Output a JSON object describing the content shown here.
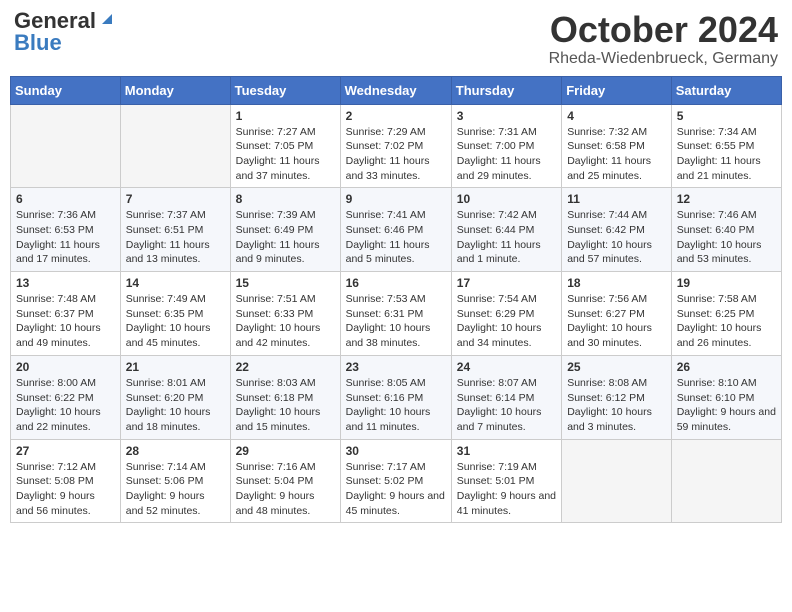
{
  "header": {
    "logo_general": "General",
    "logo_blue": "Blue",
    "month": "October 2024",
    "location": "Rheda-Wiedenbrueck, Germany"
  },
  "weekdays": [
    "Sunday",
    "Monday",
    "Tuesday",
    "Wednesday",
    "Thursday",
    "Friday",
    "Saturday"
  ],
  "weeks": [
    [
      {
        "day": "",
        "content": ""
      },
      {
        "day": "",
        "content": ""
      },
      {
        "day": "1",
        "content": "Sunrise: 7:27 AM\nSunset: 7:05 PM\nDaylight: 11 hours and 37 minutes."
      },
      {
        "day": "2",
        "content": "Sunrise: 7:29 AM\nSunset: 7:02 PM\nDaylight: 11 hours and 33 minutes."
      },
      {
        "day": "3",
        "content": "Sunrise: 7:31 AM\nSunset: 7:00 PM\nDaylight: 11 hours and 29 minutes."
      },
      {
        "day": "4",
        "content": "Sunrise: 7:32 AM\nSunset: 6:58 PM\nDaylight: 11 hours and 25 minutes."
      },
      {
        "day": "5",
        "content": "Sunrise: 7:34 AM\nSunset: 6:55 PM\nDaylight: 11 hours and 21 minutes."
      }
    ],
    [
      {
        "day": "6",
        "content": "Sunrise: 7:36 AM\nSunset: 6:53 PM\nDaylight: 11 hours and 17 minutes."
      },
      {
        "day": "7",
        "content": "Sunrise: 7:37 AM\nSunset: 6:51 PM\nDaylight: 11 hours and 13 minutes."
      },
      {
        "day": "8",
        "content": "Sunrise: 7:39 AM\nSunset: 6:49 PM\nDaylight: 11 hours and 9 minutes."
      },
      {
        "day": "9",
        "content": "Sunrise: 7:41 AM\nSunset: 6:46 PM\nDaylight: 11 hours and 5 minutes."
      },
      {
        "day": "10",
        "content": "Sunrise: 7:42 AM\nSunset: 6:44 PM\nDaylight: 11 hours and 1 minute."
      },
      {
        "day": "11",
        "content": "Sunrise: 7:44 AM\nSunset: 6:42 PM\nDaylight: 10 hours and 57 minutes."
      },
      {
        "day": "12",
        "content": "Sunrise: 7:46 AM\nSunset: 6:40 PM\nDaylight: 10 hours and 53 minutes."
      }
    ],
    [
      {
        "day": "13",
        "content": "Sunrise: 7:48 AM\nSunset: 6:37 PM\nDaylight: 10 hours and 49 minutes."
      },
      {
        "day": "14",
        "content": "Sunrise: 7:49 AM\nSunset: 6:35 PM\nDaylight: 10 hours and 45 minutes."
      },
      {
        "day": "15",
        "content": "Sunrise: 7:51 AM\nSunset: 6:33 PM\nDaylight: 10 hours and 42 minutes."
      },
      {
        "day": "16",
        "content": "Sunrise: 7:53 AM\nSunset: 6:31 PM\nDaylight: 10 hours and 38 minutes."
      },
      {
        "day": "17",
        "content": "Sunrise: 7:54 AM\nSunset: 6:29 PM\nDaylight: 10 hours and 34 minutes."
      },
      {
        "day": "18",
        "content": "Sunrise: 7:56 AM\nSunset: 6:27 PM\nDaylight: 10 hours and 30 minutes."
      },
      {
        "day": "19",
        "content": "Sunrise: 7:58 AM\nSunset: 6:25 PM\nDaylight: 10 hours and 26 minutes."
      }
    ],
    [
      {
        "day": "20",
        "content": "Sunrise: 8:00 AM\nSunset: 6:22 PM\nDaylight: 10 hours and 22 minutes."
      },
      {
        "day": "21",
        "content": "Sunrise: 8:01 AM\nSunset: 6:20 PM\nDaylight: 10 hours and 18 minutes."
      },
      {
        "day": "22",
        "content": "Sunrise: 8:03 AM\nSunset: 6:18 PM\nDaylight: 10 hours and 15 minutes."
      },
      {
        "day": "23",
        "content": "Sunrise: 8:05 AM\nSunset: 6:16 PM\nDaylight: 10 hours and 11 minutes."
      },
      {
        "day": "24",
        "content": "Sunrise: 8:07 AM\nSunset: 6:14 PM\nDaylight: 10 hours and 7 minutes."
      },
      {
        "day": "25",
        "content": "Sunrise: 8:08 AM\nSunset: 6:12 PM\nDaylight: 10 hours and 3 minutes."
      },
      {
        "day": "26",
        "content": "Sunrise: 8:10 AM\nSunset: 6:10 PM\nDaylight: 9 hours and 59 minutes."
      }
    ],
    [
      {
        "day": "27",
        "content": "Sunrise: 7:12 AM\nSunset: 5:08 PM\nDaylight: 9 hours and 56 minutes."
      },
      {
        "day": "28",
        "content": "Sunrise: 7:14 AM\nSunset: 5:06 PM\nDaylight: 9 hours and 52 minutes."
      },
      {
        "day": "29",
        "content": "Sunrise: 7:16 AM\nSunset: 5:04 PM\nDaylight: 9 hours and 48 minutes."
      },
      {
        "day": "30",
        "content": "Sunrise: 7:17 AM\nSunset: 5:02 PM\nDaylight: 9 hours and 45 minutes."
      },
      {
        "day": "31",
        "content": "Sunrise: 7:19 AM\nSunset: 5:01 PM\nDaylight: 9 hours and 41 minutes."
      },
      {
        "day": "",
        "content": ""
      },
      {
        "day": "",
        "content": ""
      }
    ]
  ]
}
